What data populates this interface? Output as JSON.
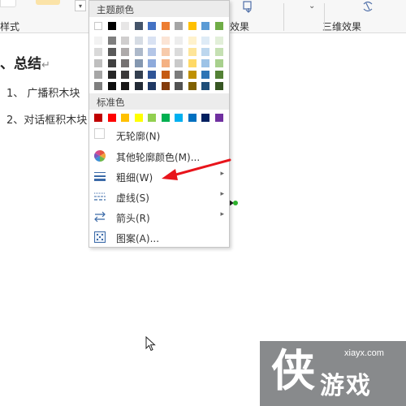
{
  "ribbon": {
    "left_label": "样式",
    "right_labels": [
      "效果",
      "三维效果"
    ],
    "scroll_glyph": "▾"
  },
  "document": {
    "heading": "、总结",
    "heading_mark": "↵",
    "lines": [
      "1、 广播积木块",
      "2、对话框积木块"
    ]
  },
  "menu": {
    "theme_colors_label": "主题颜色",
    "standard_colors_label": "标准色",
    "theme_colors": [
      [
        "#ffffff",
        "#f2f2f2",
        "#d9d9d9",
        "#bfbfbf",
        "#a6a6a6",
        "#7f7f7f"
      ],
      [
        "#000000",
        "#7f7f7f",
        "#595959",
        "#404040",
        "#262626",
        "#0d0d0d"
      ],
      [
        "#e7e6e6",
        "#d0cece",
        "#aeaaaa",
        "#757171",
        "#3a3838",
        "#171616"
      ],
      [
        "#44546a",
        "#d6dce4",
        "#adb9ca",
        "#8497b0",
        "#333f4f",
        "#222a35"
      ],
      [
        "#4472c4",
        "#d9e2f3",
        "#b4c6e7",
        "#8eaadb",
        "#2f5496",
        "#1f3864"
      ],
      [
        "#ed7d31",
        "#fbe4d5",
        "#f7cbac",
        "#f4b183",
        "#c55a11",
        "#843c0c"
      ],
      [
        "#a5a5a5",
        "#ededed",
        "#dbdbdb",
        "#c9c9c9",
        "#7b7b7b",
        "#525252"
      ],
      [
        "#ffc000",
        "#fff2cc",
        "#fee599",
        "#ffd966",
        "#bf9000",
        "#7f6000"
      ],
      [
        "#5b9bd5",
        "#deebf6",
        "#bdd7ee",
        "#9dc3e6",
        "#2e75b5",
        "#1f4e79"
      ],
      [
        "#70ad47",
        "#e2efd9",
        "#c5e0b3",
        "#a8d08d",
        "#538135",
        "#375623"
      ]
    ],
    "standard_colors": [
      "#c00000",
      "#ff0000",
      "#ffc000",
      "#ffff00",
      "#92d050",
      "#00b050",
      "#00b0f0",
      "#0070c0",
      "#002060",
      "#7030a0"
    ],
    "items": {
      "no_outline": "无轮廓(N)",
      "other_colors": "其他轮廓颜色(M)...",
      "weight": "粗细(W)",
      "dash": "虚线(S)",
      "arrow": "箭头(R)",
      "pattern": "图案(A)..."
    },
    "submenu_glyph": "▸",
    "icon_names": [
      "color-wheel-icon",
      "line-weight-icon",
      "dash-line-icon",
      "arrows-icon",
      "pattern-icon"
    ]
  },
  "annotation": {
    "color": "#e8141b"
  },
  "watermark": {
    "url": "xiayx.com",
    "text": "游戏",
    "logo_glyph": "侠"
  }
}
